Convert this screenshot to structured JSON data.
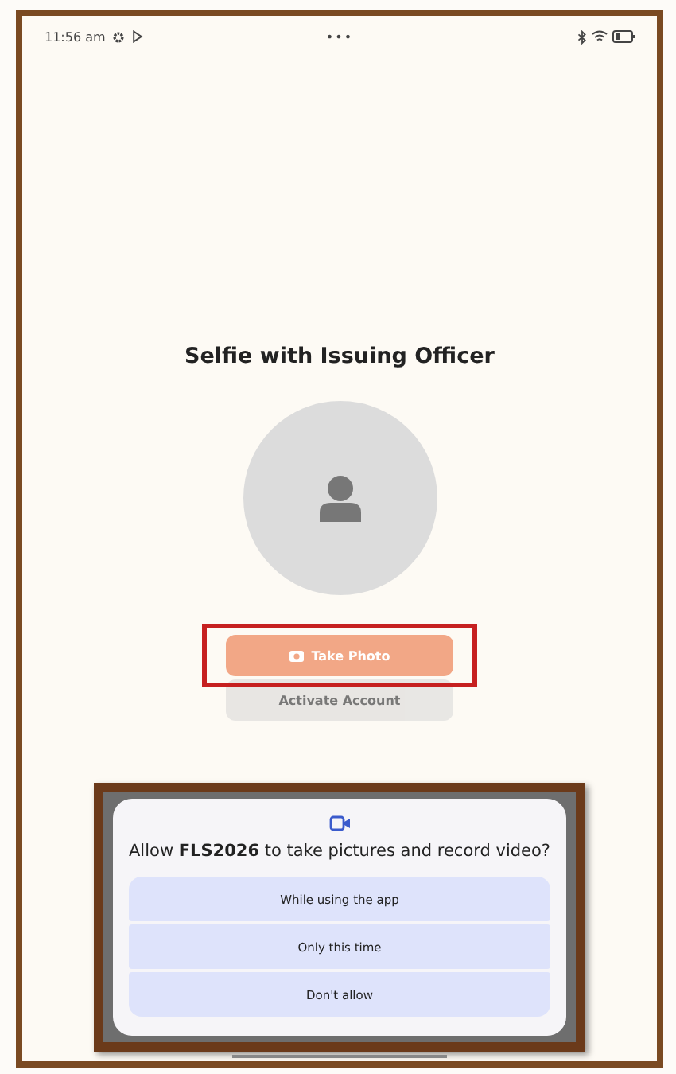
{
  "status_bar": {
    "time": "11:56 am",
    "center": "•••"
  },
  "title": "Selfie with Issuing Officer",
  "buttons": [
    {
      "label": "Take Photo",
      "kind": "primary",
      "disabled": false,
      "highlighted": true
    },
    {
      "label": "Activate Account",
      "kind": "secondary",
      "disabled": true,
      "highlighted": false
    }
  ],
  "dialog": {
    "message": "Allow **FLS2026** to take pictures and record video?",
    "options": [
      {
        "label": "While using the app"
      },
      {
        "label": "Only this time"
      },
      {
        "label": "Don't allow"
      }
    ]
  }
}
